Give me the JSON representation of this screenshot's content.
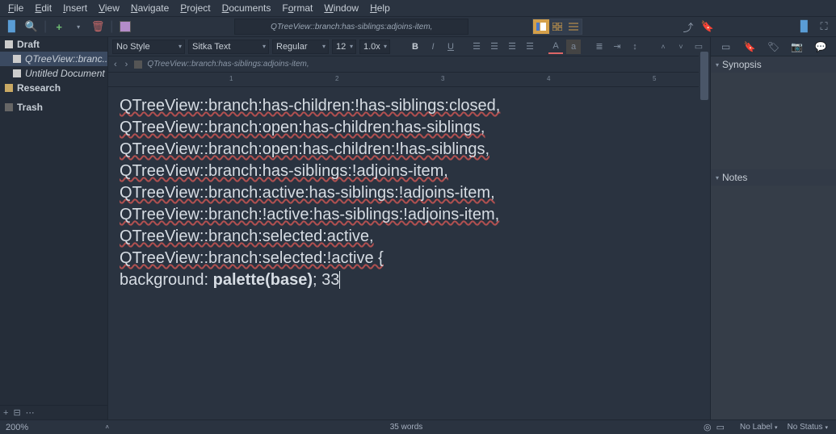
{
  "menu": {
    "items": [
      "File",
      "Edit",
      "Insert",
      "View",
      "Navigate",
      "Project",
      "Documents",
      "Format",
      "Window",
      "Help"
    ]
  },
  "title_bar": "QTreeView::branch:has-siblings:adjoins-item,",
  "toolbar": {
    "style_combo": "No Style",
    "font_combo": "Sitka Text",
    "weight_combo": "Regular",
    "size_combo": "12",
    "zoom_combo": "1.0x"
  },
  "breadcrumb": {
    "text": "QTreeView::branch:has-siblings:adjoins-item,"
  },
  "binder": {
    "items": [
      {
        "label": "Draft",
        "kind": "folder",
        "bold": true,
        "level": 0
      },
      {
        "label": "QTreeView::branc...",
        "kind": "file",
        "level": 1,
        "selected": true,
        "italic": true
      },
      {
        "label": "Untitled Document",
        "kind": "file",
        "level": 1,
        "italic": true
      },
      {
        "label": "Research",
        "kind": "research",
        "bold": true,
        "level": 0
      },
      {
        "label": "Trash",
        "kind": "trash",
        "bold": true,
        "level": 0
      }
    ]
  },
  "editor": {
    "lines": [
      "QTreeView::branch:has-children:!has-siblings:closed,",
      "QTreeView::branch:open:has-children:has-siblings,",
      "QTreeView::branch:open:has-children:!has-siblings,",
      "QTreeView::branch:has-siblings:!adjoins-item,",
      "QTreeView::branch:active:has-siblings:!adjoins-item,",
      "QTreeView::branch:!active:has-siblings:!adjoins-item,",
      "QTreeView::branch:selected:active,",
      "QTreeView::branch:selected:!active {",
      "background: palette(base); 33"
    ],
    "bold_fragment": "palette(base)"
  },
  "right_panel": {
    "synopsis_label": "Synopsis",
    "notes_label": "Notes"
  },
  "status": {
    "zoom": "200%",
    "words": "35 words",
    "label_combo": "No Label",
    "status_combo": "No Status"
  }
}
